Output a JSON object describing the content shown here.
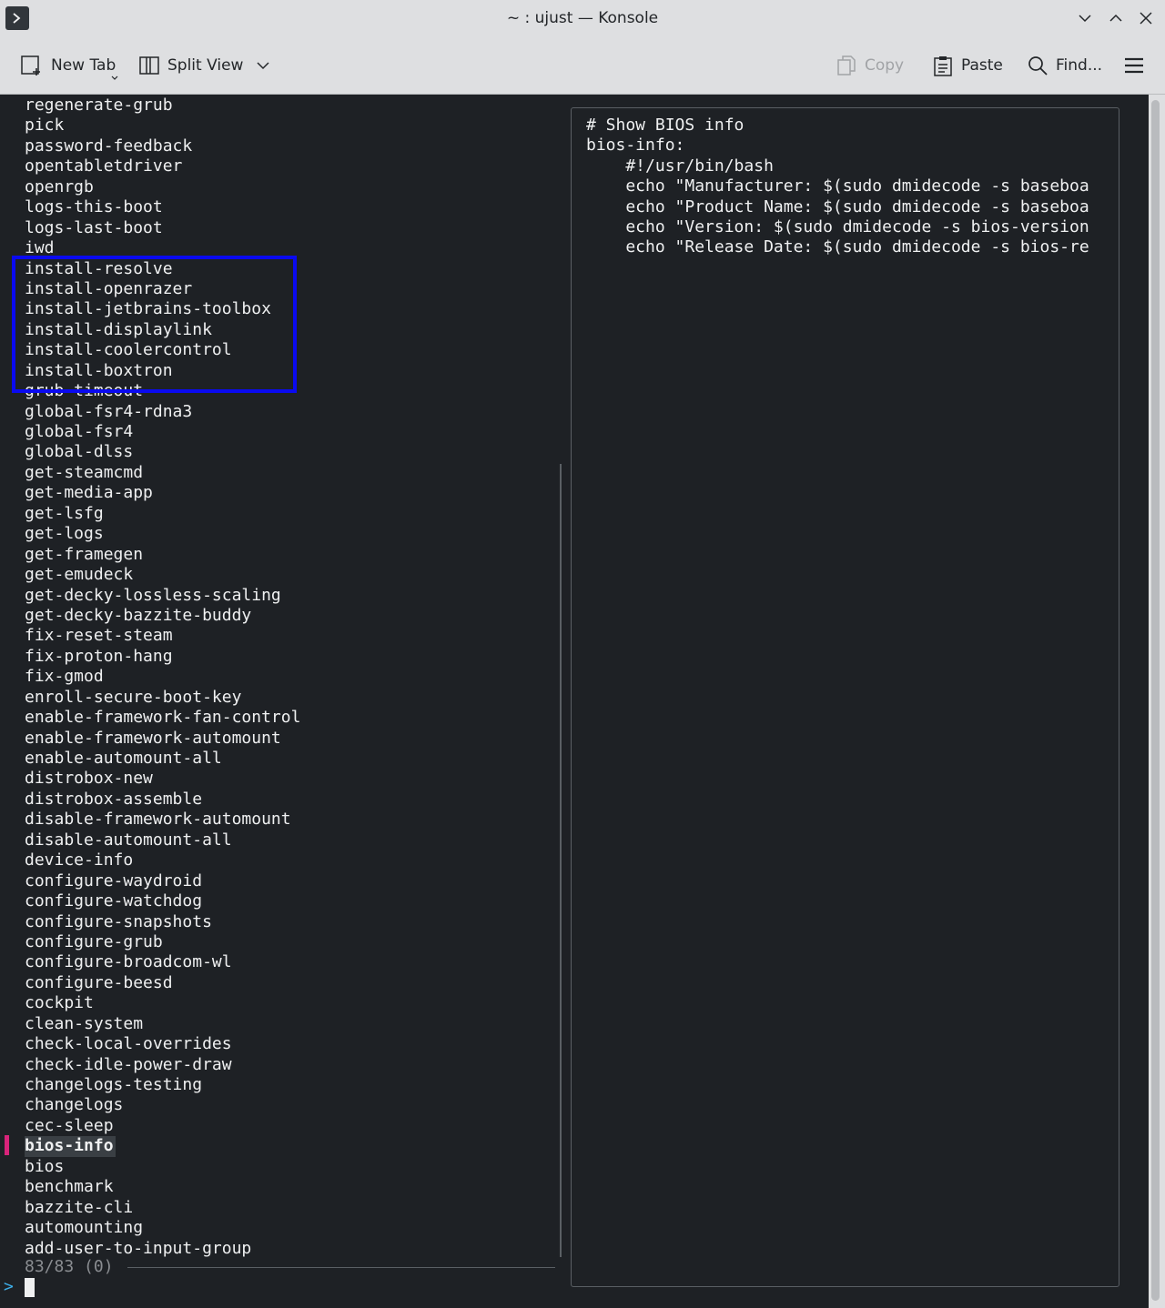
{
  "window": {
    "title": "~ : ujust — Konsole"
  },
  "toolbar": {
    "new_tab": "New Tab",
    "split_view": "Split View",
    "copy": "Copy",
    "paste": "Paste",
    "find": "Find..."
  },
  "fzf": {
    "items": [
      "regenerate-grub",
      "pick",
      "password-feedback",
      "opentabletdriver",
      "openrgb",
      "logs-this-boot",
      "logs-last-boot",
      "iwd",
      "install-resolve",
      "install-openrazer",
      "install-jetbrains-toolbox",
      "install-displaylink",
      "install-coolercontrol",
      "install-boxtron",
      "grub-timeout",
      "global-fsr4-rdna3",
      "global-fsr4",
      "global-dlss",
      "get-steamcmd",
      "get-media-app",
      "get-lsfg",
      "get-logs",
      "get-framegen",
      "get-emudeck",
      "get-decky-lossless-scaling",
      "get-decky-bazzite-buddy",
      "fix-reset-steam",
      "fix-proton-hang",
      "fix-gmod",
      "enroll-secure-boot-key",
      "enable-framework-fan-control",
      "enable-framework-automount",
      "enable-automount-all",
      "distrobox-new",
      "distrobox-assemble",
      "disable-framework-automount",
      "disable-automount-all",
      "device-info",
      "configure-waydroid",
      "configure-watchdog",
      "configure-snapshots",
      "configure-grub",
      "configure-broadcom-wl",
      "configure-beesd",
      "cockpit",
      "clean-system",
      "check-local-overrides",
      "check-idle-power-draw",
      "changelogs-testing",
      "changelogs",
      "cec-sleep",
      "bios-info",
      "bios",
      "benchmark",
      "bazzite-cli",
      "automounting",
      "add-user-to-input-group"
    ],
    "selected": "bios-info",
    "counter": "83/83 (0)",
    "prompt": ">"
  },
  "preview": {
    "lines": [
      "# Show BIOS info",
      "bios-info:",
      "    #!/usr/bin/bash",
      "    echo \"Manufacturer: $(sudo dmidecode -s baseboa",
      "    echo \"Product Name: $(sudo dmidecode -s baseboa",
      "    echo \"Version: $(sudo dmidecode -s bios-version",
      "    echo \"Release Date: $(sudo dmidecode -s bios-re"
    ]
  },
  "colors": {
    "highlight_box": "#0a0af0",
    "selection_marker": "#d8247a",
    "terminal_bg": "#1e2125",
    "chrome_bg": "#dedfe1"
  }
}
